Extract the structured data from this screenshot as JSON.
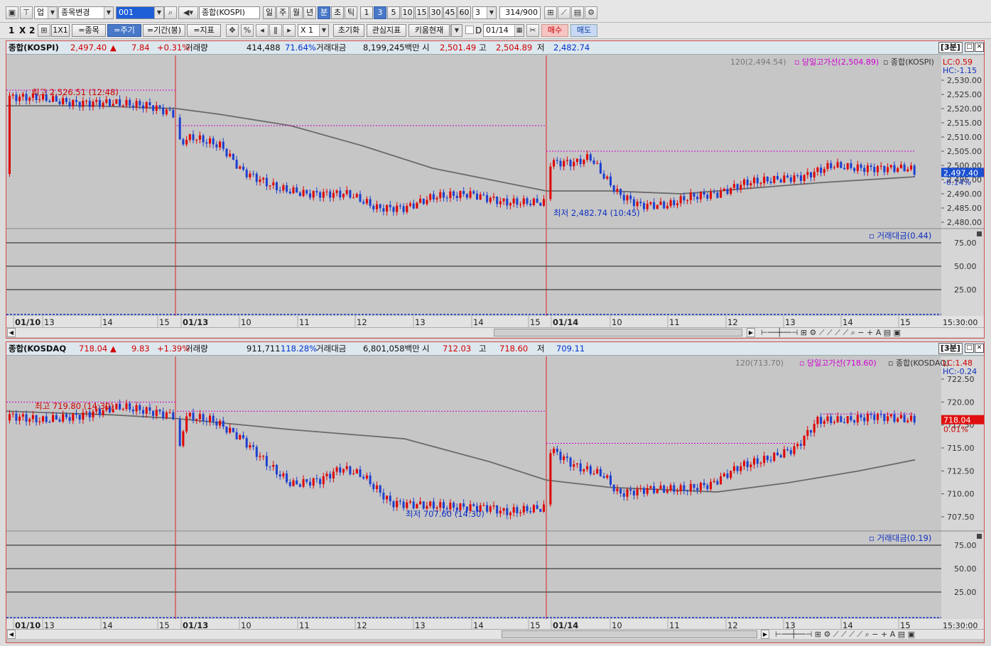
{
  "toolbar1": {
    "market": "업",
    "change_label": "종목변경",
    "code": "001",
    "name": "종합(KOSPI)",
    "periods": [
      "일",
      "주",
      "월",
      "년",
      "분",
      "초",
      "틱"
    ],
    "active_period": "분",
    "intervals": [
      "1",
      "3",
      "5",
      "10",
      "15",
      "30",
      "45",
      "60"
    ],
    "active_interval": "3",
    "interval_value": "3",
    "count": "314",
    "count_total": "/900"
  },
  "toolbar2": {
    "layout_1": "1",
    "layout_x": "X",
    "layout_2": "2",
    "grid_1x1": "1X1",
    "stock_btn": "=종목",
    "period_btn": "=주기",
    "range_btn": "=기간(봉)",
    "indicator_btn": "=지표",
    "zoom": "X 1",
    "reset_btn": "초기화",
    "interest_btn": "관심지표",
    "kiwoom_btn": "키움현재",
    "d_label": "D",
    "date_value": "01/14",
    "buy_btn": "매수",
    "sell_btn": "매도"
  },
  "panels": [
    {
      "id": "kospi",
      "name": "종합(KOSPI)",
      "price": "2,497.40",
      "change": "7.84",
      "change_pct": "+0.31%",
      "vol_label": "거래량",
      "volume": "414,488",
      "vol_ratio": "71.64%",
      "amt_label": "거래대금",
      "amount": "8,199,245백만",
      "open_label": "시",
      "open": "2,501.49",
      "high_label": "고",
      "high": "2,504.89",
      "low_label": "저",
      "low": "2,482.74",
      "interval_tag": "[3분]",
      "legend_ma": "120(2,494.54)",
      "legend_high": "당일고가선(2,504.89)",
      "legend_name": "종합(KOSPI)",
      "lc": "LC:0.59",
      "hc": "HC:-1.15",
      "cur_price": "2,497.40",
      "cur_pct": "-0.14%",
      "hi_annot": "최고 2,526.51 (12:48)",
      "lo_annot": "최저 2,482.74 (10:45)",
      "y_ticks": [
        "2,530.00",
        "2,525.00",
        "2,520.00",
        "2,515.00",
        "2,510.00",
        "2,505.00",
        "2,500.00",
        "2,495.00",
        "2,490.00",
        "2,485.00",
        "2,480.00"
      ],
      "sub_label": "거래대금(0.44)",
      "sub_ticks": [
        "75.00",
        "50.00",
        "25.00"
      ],
      "time_end": "15:30:00"
    },
    {
      "id": "kosdaq",
      "name": "종합(KOSDAQ",
      "price": "718.04",
      "change": "9.83",
      "change_pct": "+1.39%",
      "vol_label": "거래량",
      "volume": "911,711",
      "vol_ratio": "118.28%",
      "amt_label": "거래대금",
      "amount": "6,801,058백만",
      "open_label": "시",
      "open": "712.03",
      "high_label": "고",
      "high": "718.60",
      "low_label": "저",
      "low": "709.11",
      "interval_tag": "[3분]",
      "legend_ma": "120(713.70)",
      "legend_high": "당일고가선(718.60)",
      "legend_name": "종합(KOSDAQ)",
      "lc": "LC:1.48",
      "hc": "HC:-0.24",
      "cur_price": "718.04",
      "cur_pct": "0.01%",
      "hi_annot": "최고 719.80 (14:30)",
      "lo_annot": "최저 707.60 (14:30)",
      "y_ticks": [
        "722.50",
        "720.00",
        "717.50",
        "715.00",
        "712.50",
        "710.00",
        "707.50"
      ],
      "sub_label": "거래대금(0.19)",
      "sub_ticks": [
        "75.00",
        "50.00",
        "25.00"
      ],
      "time_end": "15:30:00"
    }
  ],
  "x_axis": [
    "01/10",
    "13",
    "14",
    "15",
    "01/13",
    "10",
    "11",
    "12",
    "13",
    "14",
    "15",
    "01/14",
    "10",
    "11",
    "12",
    "13",
    "14",
    "15"
  ],
  "colors": {
    "up": "#e00000",
    "down": "#1c3fd0",
    "ma": "#6a6a6a",
    "high_line": "#d000d0",
    "day_sep": "#e02020"
  }
}
